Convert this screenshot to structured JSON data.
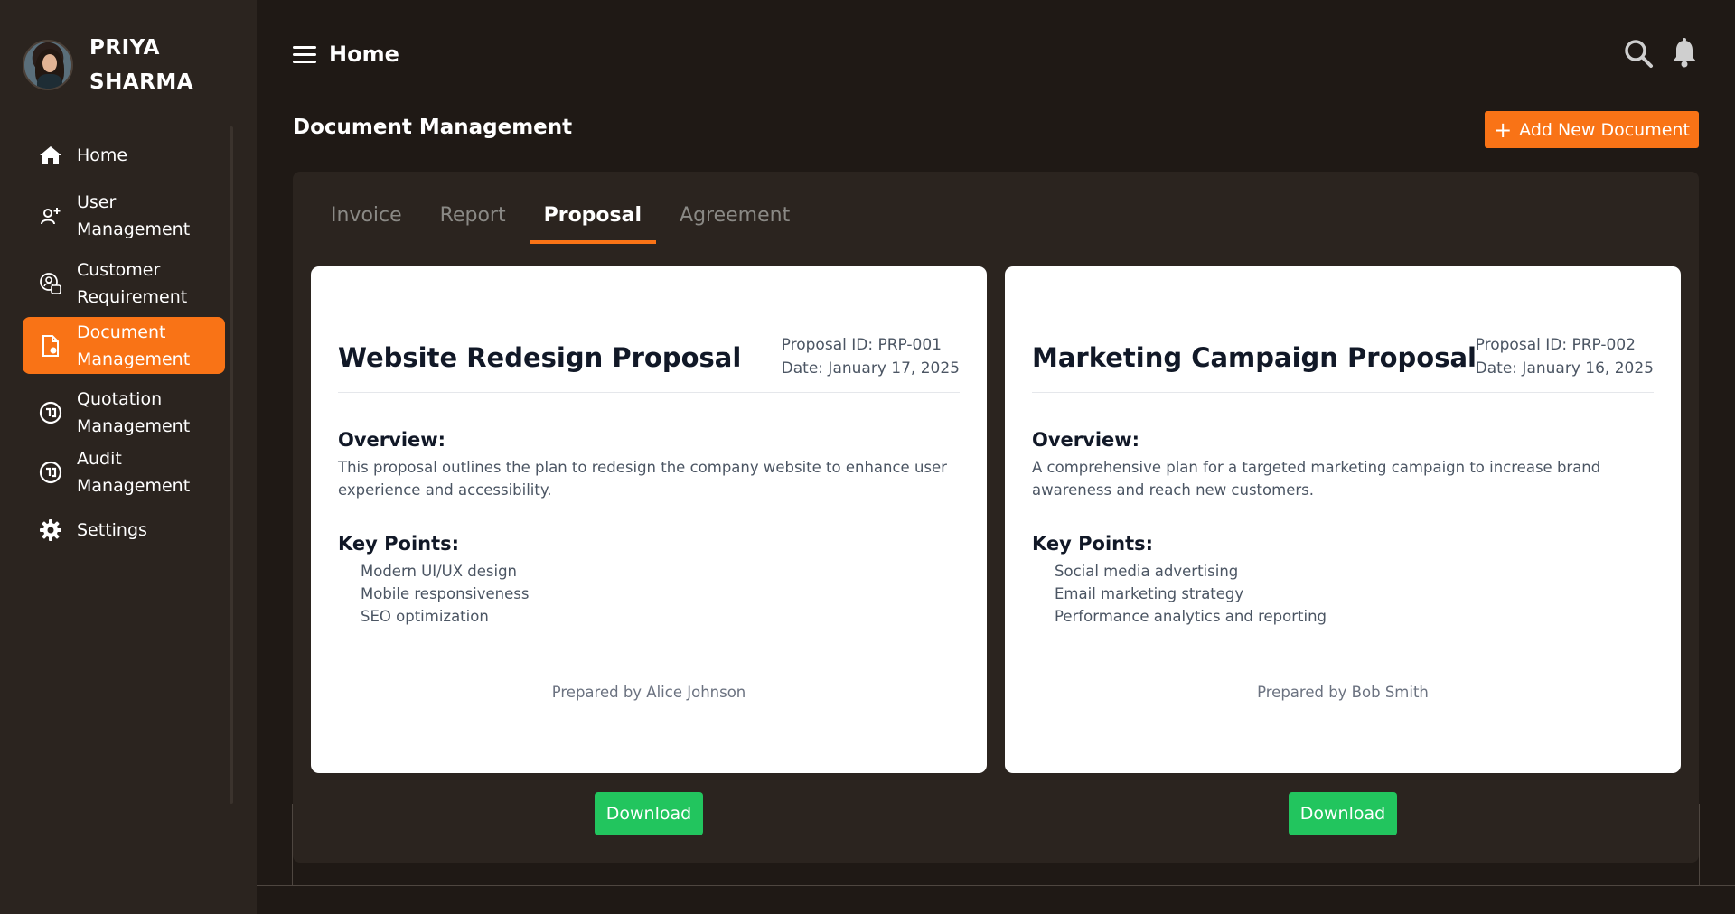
{
  "user": {
    "first_name": "PRIYA",
    "last_name": "SHARMA"
  },
  "sidebar": {
    "items": [
      {
        "line1": "Home",
        "line2": "",
        "icon": "home-icon"
      },
      {
        "line1": "User",
        "line2": "Management",
        "icon": "user-add-icon"
      },
      {
        "line1": "Customer",
        "line2": "Requirement",
        "icon": "customer-requirement-icon"
      },
      {
        "line1": "Document",
        "line2": "Management",
        "icon": "document-icon",
        "active": true
      },
      {
        "line1": "Quotation",
        "line2": "Management",
        "icon": "quotation-icon"
      },
      {
        "line1": "Audit",
        "line2": "Management",
        "icon": "audit-icon"
      },
      {
        "line1": "Settings",
        "line2": "",
        "icon": "gear-icon"
      }
    ]
  },
  "header": {
    "title": "Home"
  },
  "page": {
    "title": "Document Management",
    "add_button": "Add New Document"
  },
  "tabs": [
    {
      "label": "Invoice"
    },
    {
      "label": "Report"
    },
    {
      "label": "Proposal",
      "active": true
    },
    {
      "label": "Agreement"
    }
  ],
  "proposals": [
    {
      "title": "Website Redesign Proposal",
      "id_text": "Proposal ID: PRP-001",
      "date_text": "Date: January 17, 2025",
      "overview_heading": "Overview:",
      "overview": "This proposal outlines the plan to redesign the company website to enhance user experience and accessibility.",
      "key_points_heading": "Key Points:",
      "key_points": [
        "Modern UI/UX design",
        "Mobile responsiveness",
        "SEO optimization"
      ],
      "prepared_by": "Prepared by Alice Johnson",
      "download_label": "Download"
    },
    {
      "title": "Marketing Campaign Proposal",
      "id_text": "Proposal ID: PRP-002",
      "date_text": "Date: January 16, 2025",
      "overview_heading": "Overview:",
      "overview": "A comprehensive plan for a targeted marketing campaign to increase brand awareness and reach new customers.",
      "key_points_heading": "Key Points:",
      "key_points": [
        "Social media advertising",
        "Email marketing strategy",
        "Performance analytics and reporting"
      ],
      "prepared_by": "Prepared by Bob Smith",
      "download_label": "Download"
    }
  ],
  "colors": {
    "accent": "#f97316",
    "download": "#22c55e",
    "sidebar": "#2b241f",
    "background": "#1f1915"
  }
}
